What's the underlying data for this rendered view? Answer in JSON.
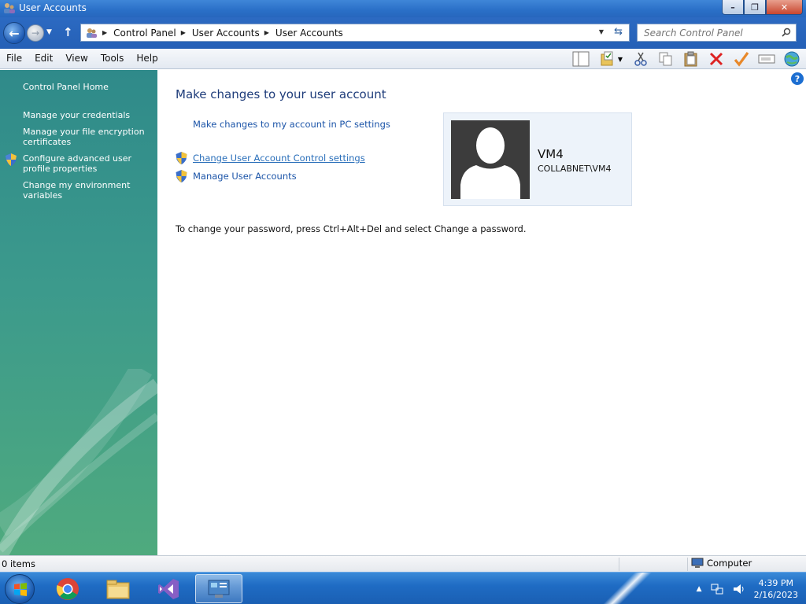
{
  "window": {
    "title": "User Accounts",
    "controls": {
      "minimize": "–",
      "maximize": "❐",
      "close": "✕"
    }
  },
  "address_bar": {
    "breadcrumbs": [
      "Control Panel",
      "User Accounts",
      "User Accounts"
    ]
  },
  "search": {
    "placeholder": "Search Control Panel"
  },
  "menu": {
    "file": "File",
    "edit": "Edit",
    "view": "View",
    "tools": "Tools",
    "help": "Help"
  },
  "sidebar": {
    "home": "Control Panel Home",
    "items": [
      {
        "label": "Manage your credentials"
      },
      {
        "label": "Manage your file encryption certificates"
      },
      {
        "label": "Configure advanced user profile properties"
      },
      {
        "label": "Change my environment variables"
      }
    ]
  },
  "main": {
    "heading": "Make changes to your user account",
    "pc_settings_link": "Make changes to my account in PC settings",
    "uac_link": "Change User Account Control settings",
    "manage_link": "Manage User Accounts",
    "password_note": "To change your password, press Ctrl+Alt+Del and select Change a password.",
    "account": {
      "name": "VM4",
      "domain": "COLLABNET\\VM4"
    }
  },
  "statusbar": {
    "items": "0 items",
    "location": "Computer"
  },
  "taskbar": {
    "time": "4:39 PM",
    "date": "2/16/2023"
  },
  "colors": {
    "title_bar": "#2a6fc7",
    "link": "#1b54a8",
    "sidebar": "#3c9a8c",
    "taskbar": "#1f6cc4"
  }
}
